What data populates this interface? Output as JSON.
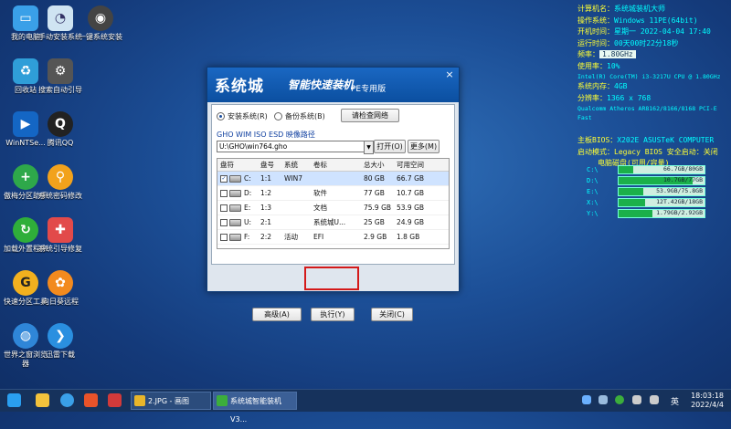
{
  "desktop_icons": [
    {
      "id": "my-computer",
      "label": "我的电脑",
      "color": "#3aa0e8",
      "glyph": "▭"
    },
    {
      "id": "ghost-install",
      "label": "手动安装系统",
      "color": "#cfe4f2",
      "glyph": "◔"
    },
    {
      "id": "one-key-install",
      "label": "一键系统安装",
      "color": "#444",
      "glyph": "◉"
    },
    {
      "id": "recycle-bin",
      "label": "回收站",
      "color": "#2f9ed8",
      "glyph": "♻"
    },
    {
      "id": "search-auto-boot",
      "label": "搜索自动引导",
      "color": "#555",
      "glyph": "⚙"
    },
    {
      "id": "winntsetup",
      "label": "WinNTSe...",
      "color": "#1466c4",
      "glyph": "▶"
    },
    {
      "id": "tencent-qq",
      "label": "腾讯QQ",
      "color": "#222",
      "glyph": "Q"
    },
    {
      "id": "diskgenius",
      "label": "傲梅分区助手",
      "color": "#2ea84a",
      "glyph": "+"
    },
    {
      "id": "password-reset",
      "label": "系统密码修改",
      "color": "#f2a21c",
      "glyph": "⚲"
    },
    {
      "id": "bootice",
      "label": "加载外置程序",
      "color": "#2fae3a",
      "glyph": "↻"
    },
    {
      "id": "boot-repair",
      "label": "系统引导修复",
      "color": "#e24a4a",
      "glyph": "✚"
    },
    {
      "id": "quick-partition",
      "label": "快速分区工具",
      "color": "#f2b01e",
      "glyph": "G"
    },
    {
      "id": "sunlogin",
      "label": "向日葵远程",
      "color": "#f28a1e",
      "glyph": "✿"
    },
    {
      "id": "world-browser",
      "label": "世界之窗浏览器",
      "color": "#2f86d8",
      "glyph": "◍"
    },
    {
      "id": "thunder",
      "label": "迅雷下载",
      "color": "#2a8fe0",
      "glyph": "❯"
    }
  ],
  "info_panel": {
    "rows": [
      {
        "k": "计算机名：",
        "v": "系统城装机大师"
      },
      {
        "k": "操作系统：",
        "v": "Windows 11PE(64bit)"
      },
      {
        "k": "开机时间：",
        "v": "星期一 2022-04-04 17:40"
      },
      {
        "k": "运行时间：",
        "v": "00天00时22分18秒"
      },
      {
        "k": "   频率：",
        "v": "1.80GHz"
      },
      {
        "k": "  使用率：",
        "v": "10%"
      }
    ],
    "cpu_line": "Intel(R) Core(TM) i3-3217U CPU @ 1.80GHz",
    "rows2": [
      {
        "k": "系统内存：",
        "v": "4GB"
      },
      {
        "k": "分辨率：",
        "v": "1366 x 768"
      }
    ],
    "net_line": "Qualcomm Atheros AR8162/8166/8168 PCI-E Fast",
    "bios": {
      "k": "主板BIOS：",
      "v": "X202E ASUSTeK COMPUTER"
    },
    "boot": {
      "k": "启动模式：",
      "v": "Legacy BIOS 安全启动：关闭"
    },
    "disk_title": "电脑磁盘(可用/容量)"
  },
  "drives": [
    {
      "label": "C:\\",
      "text": "66.7GB/80GB",
      "used": 0.17
    },
    {
      "label": "D:\\",
      "text": "10.7GB/77GB",
      "used": 0.86
    },
    {
      "label": "E:\\",
      "text": "53.9GB/75.8GB",
      "used": 0.29
    },
    {
      "label": "X:\\",
      "text": "12T.42GB/18GB",
      "used": 0.31
    },
    {
      "label": "Y:\\",
      "text": "1.79GB/2.92GB",
      "used": 0.39
    }
  ],
  "dialog": {
    "title_main": "系统城",
    "title_sub": "智能快速装机",
    "title_pe": "PE专用版",
    "close_glyph": "×",
    "radio_install": "安装系统(R)",
    "radio_backup": "备份系统(B)",
    "check_net": "请检查网络",
    "path_label": "GHO WIM ISO ESD 映像路径",
    "path_value": "U:\\GHO\\win764.gho",
    "open_btn": "打开(O)",
    "more_btn": "更多(M)",
    "columns": [
      "盘符",
      "盘号",
      "系统",
      "卷标",
      "总大小",
      "可用空间"
    ],
    "rows": [
      {
        "drive": "C:",
        "num": "1:1",
        "sys": "WIN7",
        "label": "",
        "total": "80 GB",
        "free": "66.7 GB",
        "checked": "✓",
        "selected": true
      },
      {
        "drive": "D:",
        "num": "1:2",
        "sys": "",
        "label": "软件",
        "total": "77 GB",
        "free": "10.7 GB",
        "checked": "",
        "selected": false
      },
      {
        "drive": "E:",
        "num": "1:3",
        "sys": "",
        "label": "文档",
        "total": "75.9 GB",
        "free": "53.9 GB",
        "checked": "",
        "selected": false
      },
      {
        "drive": "U:",
        "num": "2:1",
        "sys": "",
        "label": "系统城U...",
        "total": "25 GB",
        "free": "24.9 GB",
        "checked": "",
        "selected": false
      },
      {
        "drive": "F:",
        "num": "2:2",
        "sys": "活动",
        "label": "EFI",
        "total": "2.9 GB",
        "free": "1.8 GB",
        "checked": "",
        "selected": false
      }
    ],
    "advanced_btn": "高级(A)",
    "execute_btn": "执行(Y)",
    "close_btn": "关闭(C)"
  },
  "taskbar": {
    "tasks": [
      {
        "label": "2.JPG - 画图",
        "color": "#e8b52a"
      },
      {
        "label": "系统城智能装机 V3...",
        "color": "#3cae3c"
      }
    ],
    "tray_lang": "英",
    "time": "18:03:18",
    "date": "2022/4/4"
  }
}
